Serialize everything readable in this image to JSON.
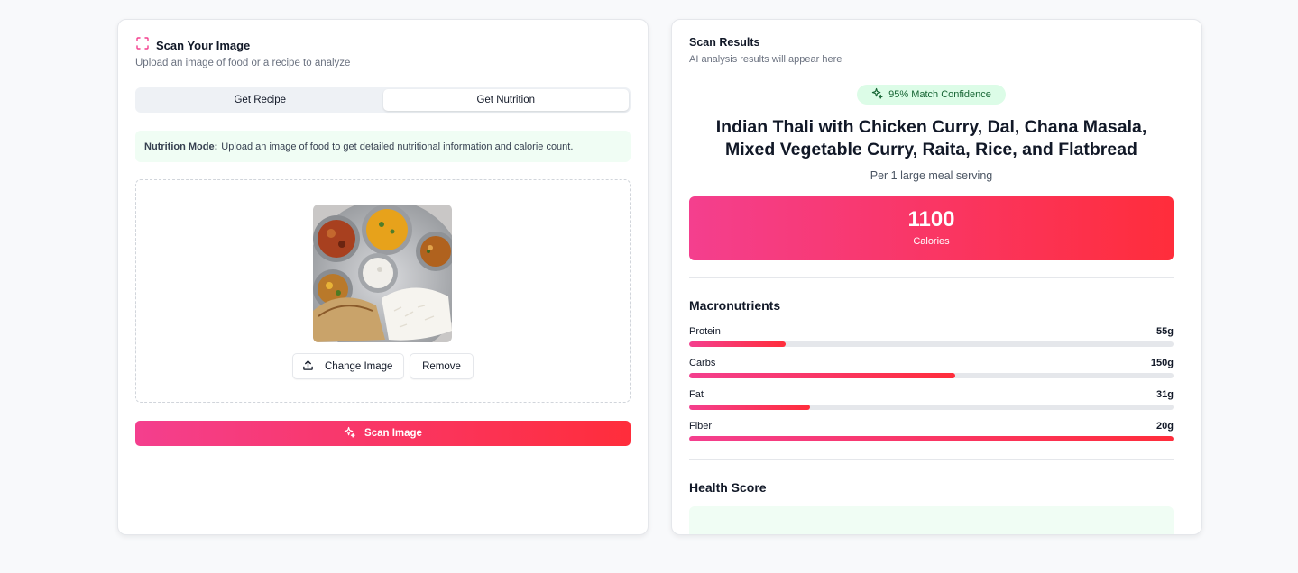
{
  "scan_panel": {
    "title": "Scan Your Image",
    "subtitle": "Upload an image of food or a recipe to analyze",
    "tabs": [
      {
        "label": "Get Recipe",
        "active": false
      },
      {
        "label": "Get Nutrition",
        "active": true
      }
    ],
    "notice": {
      "mode_label": "Nutrition Mode:",
      "text": "Upload an image of food to get detailed nutritional information and calorie count."
    },
    "change_image_label": "Change Image",
    "remove_label": "Remove",
    "scan_button_label": "Scan Image",
    "icons": {
      "header": "scan-frame-icon",
      "upload": "upload-icon",
      "scan": "sparkles-icon"
    }
  },
  "results_panel": {
    "title": "Scan Results",
    "subtitle": "AI analysis results will appear here",
    "confidence_badge": "95% Match Confidence",
    "dish_name": "Indian Thali with Chicken Curry, Dal, Chana Masala, Mixed Vegetable Curry, Raita, Rice, and Flatbread",
    "serving": "Per 1 large meal serving",
    "calories": {
      "value": "1100",
      "label": "Calories"
    },
    "macronutrients_title": "Macronutrients",
    "macros": [
      {
        "name": "Protein",
        "value": "55g",
        "fraction": 0.2
      },
      {
        "name": "Carbs",
        "value": "150g",
        "fraction": 0.55
      },
      {
        "name": "Fat",
        "value": "31g",
        "fraction": 0.25
      },
      {
        "name": "Fiber",
        "value": "20g",
        "fraction": 1.0
      }
    ],
    "health_score_title": "Health Score"
  },
  "colors": {
    "accent_start": "#f43f8e",
    "accent_end": "#ff2d3b",
    "success_bg": "#dcfce7",
    "success_text": "#166534"
  }
}
